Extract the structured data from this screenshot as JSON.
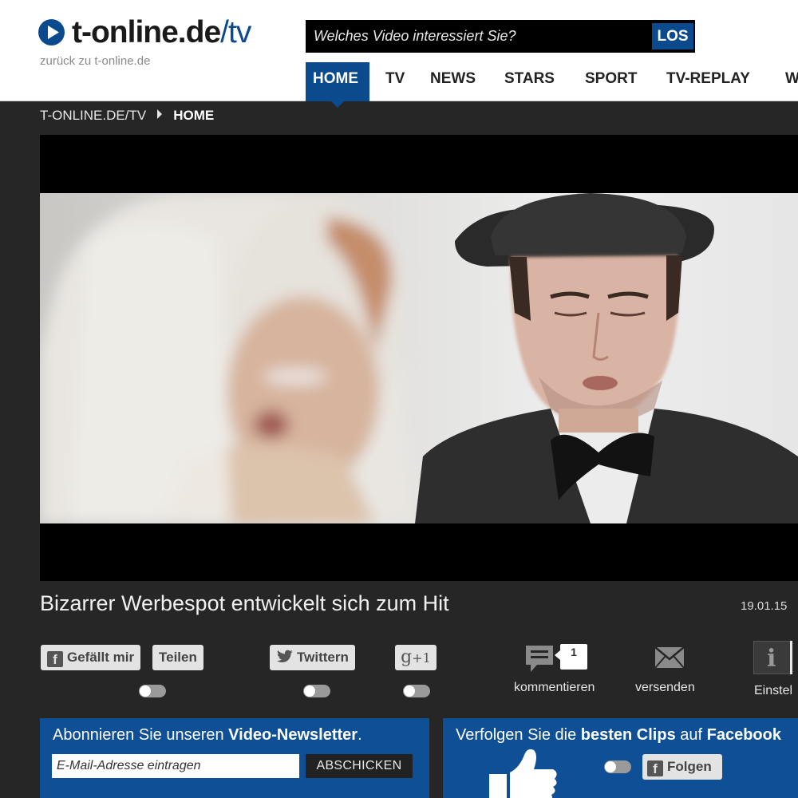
{
  "brand": {
    "logo_main": "t-online.de",
    "logo_suffix": "/tv",
    "back_link": "zurück zu t-online.de",
    "accent_color": "#0c4a8e"
  },
  "search": {
    "placeholder": "Welches Video interessiert Sie?",
    "button_label": "LOS"
  },
  "nav": {
    "items": [
      {
        "label": "HOME",
        "active": true
      },
      {
        "label": "TV"
      },
      {
        "label": "NEWS"
      },
      {
        "label": "STARS"
      },
      {
        "label": "SPORT"
      },
      {
        "label": "TV-REPLAY"
      },
      {
        "label": "W"
      }
    ]
  },
  "breadcrumb": {
    "root": "T-ONLINE.DE/TV",
    "current": "HOME"
  },
  "video": {
    "title": "Bizarrer Werbespot entwickelt sich zum Hit",
    "date": "19.01.15"
  },
  "share": {
    "facebook_like": "Gefällt mir",
    "facebook_share": "Teilen",
    "twitter": "Twittern",
    "gplus": "+1",
    "comment_count": "1",
    "comment_label": "kommentieren",
    "send_label": "versenden",
    "settings_label": "Einstel"
  },
  "newsletter": {
    "text_prefix": "Abonnieren Sie unseren ",
    "text_bold": "Video-Newsletter",
    "text_suffix": ".",
    "email_placeholder": "E-Mail-Adresse eintragen",
    "submit_label": "ABSCHICKEN"
  },
  "facebook_panel": {
    "text_prefix": "Verfolgen Sie die ",
    "text_bold1": "besten Clips",
    "text_middle": " auf ",
    "text_bold2": "Facebook",
    "follow_label": "Folgen"
  }
}
